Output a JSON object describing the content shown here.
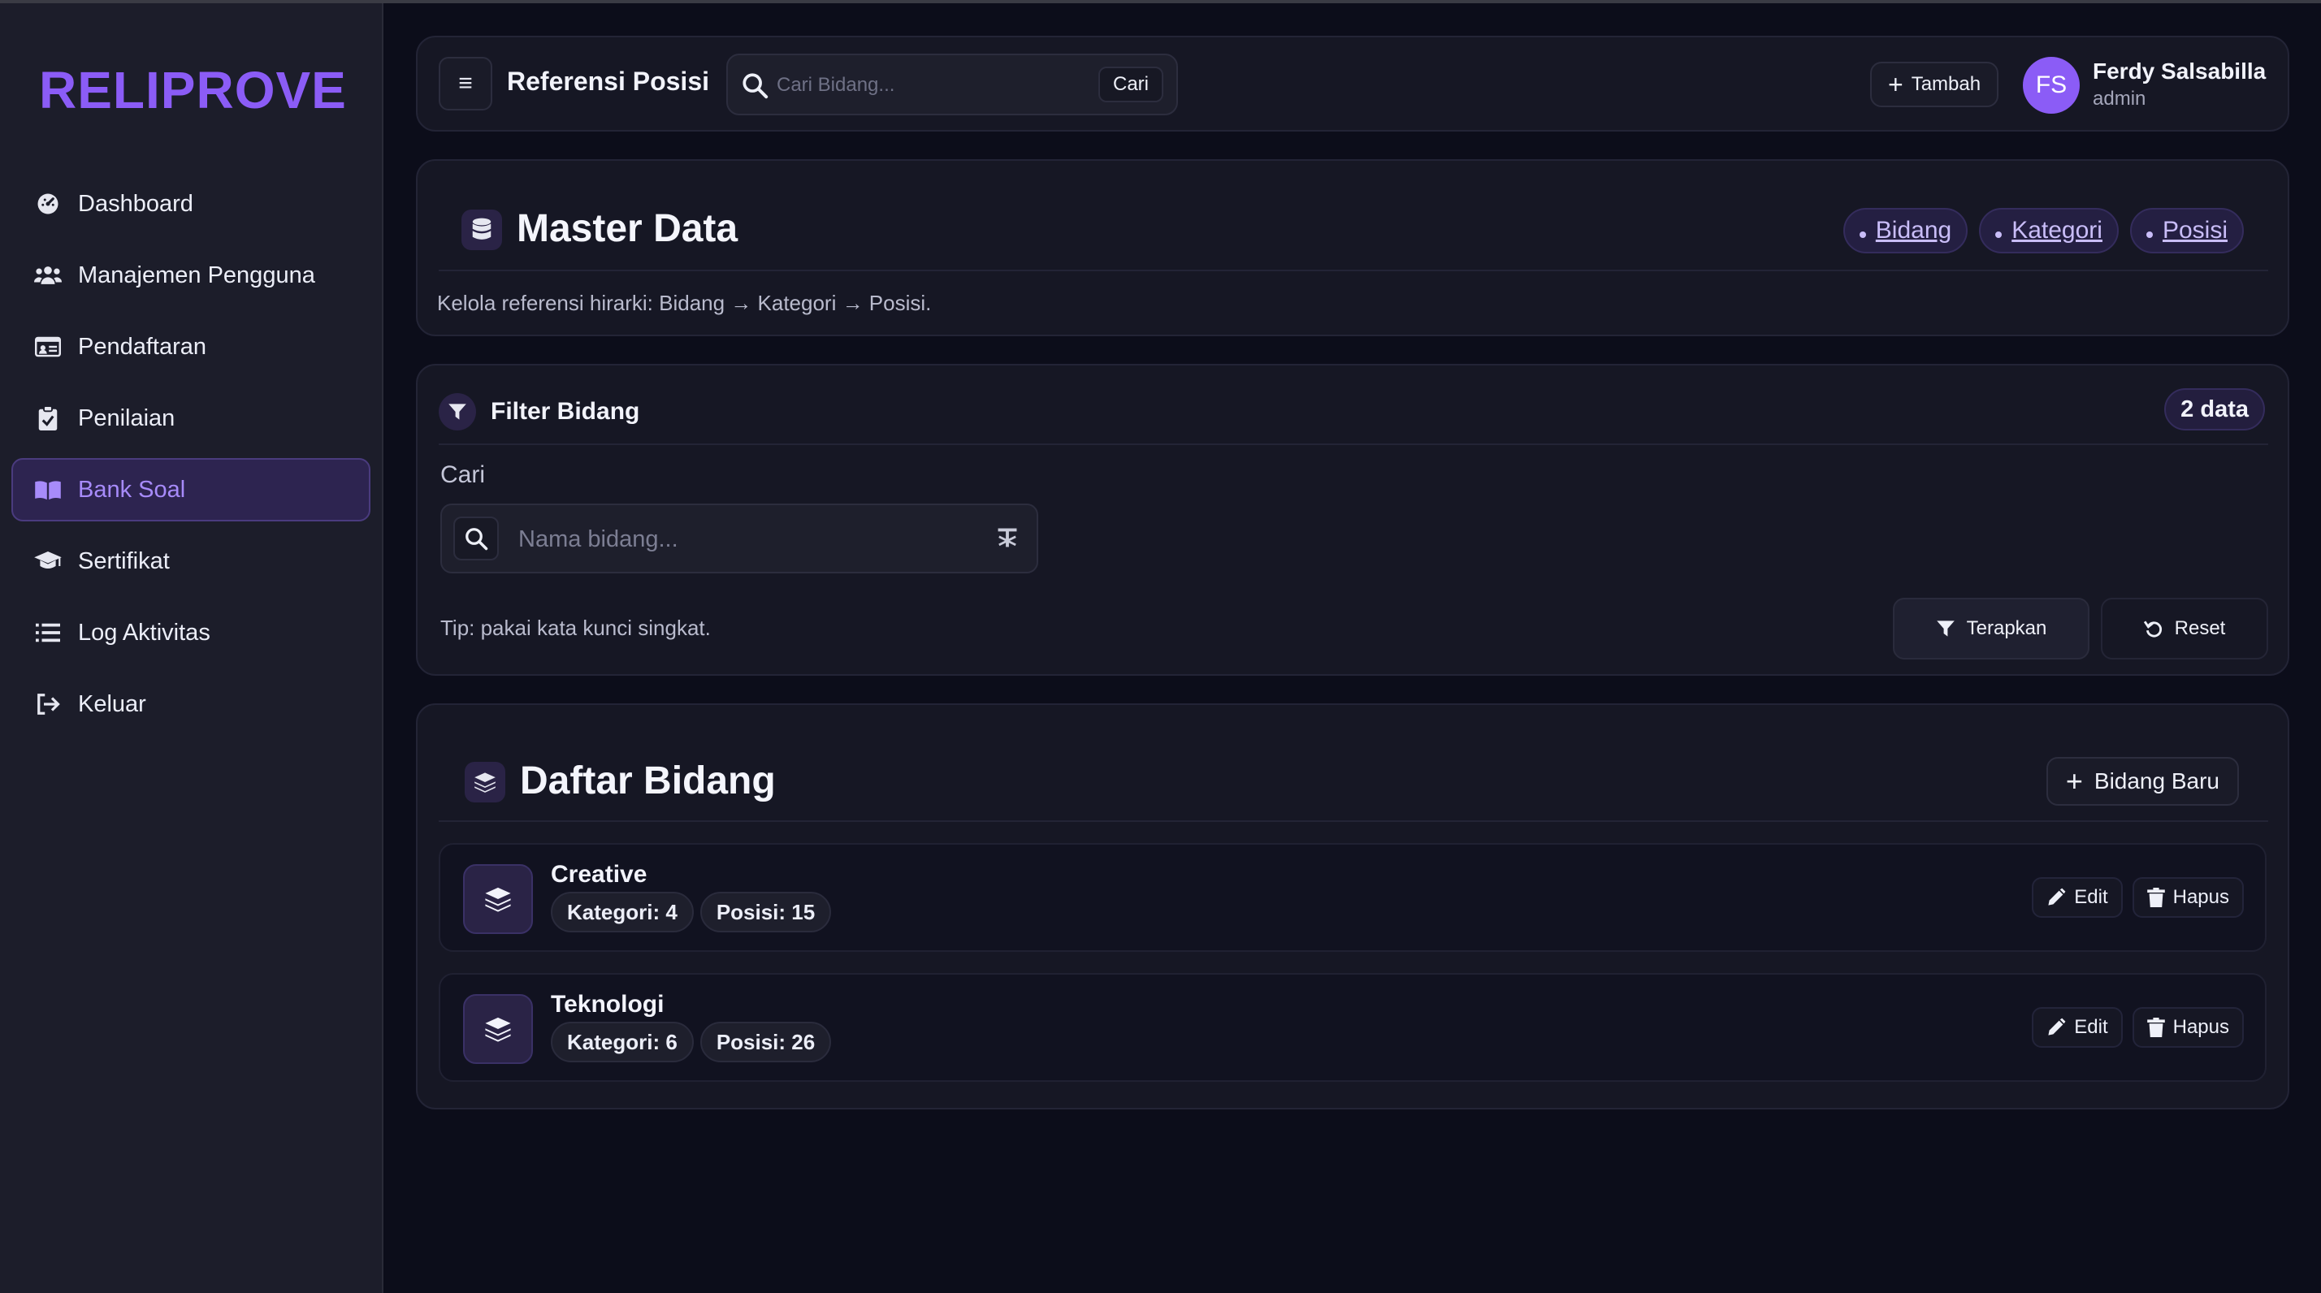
{
  "brand": "RELIPROVE",
  "sidebar": {
    "items": [
      {
        "label": "Dashboard",
        "icon": "dashboard-icon"
      },
      {
        "label": "Manajemen Pengguna",
        "icon": "users-icon"
      },
      {
        "label": "Pendaftaran",
        "icon": "id-card-icon"
      },
      {
        "label": "Penilaian",
        "icon": "clipboard-check-icon"
      },
      {
        "label": "Bank Soal",
        "icon": "book-open-icon",
        "active": true
      },
      {
        "label": "Sertifikat",
        "icon": "graduation-cap-icon"
      },
      {
        "label": "Log Aktivitas",
        "icon": "list-icon"
      },
      {
        "label": "Keluar",
        "icon": "logout-icon"
      }
    ]
  },
  "header": {
    "title": "Referensi Posisi",
    "search_placeholder": "Cari Bidang...",
    "search_button": "Cari",
    "add_button": "Tambah",
    "user": {
      "initials": "FS",
      "name": "Ferdy Salsabilla",
      "role": "admin"
    }
  },
  "master": {
    "title": "Master Data",
    "chips": [
      "Bidang",
      "Kategori",
      "Posisi"
    ],
    "description": "Kelola referensi hirarki: Bidang → Kategori → Posisi."
  },
  "filter": {
    "title": "Filter Bidang",
    "count": "2 data",
    "label": "Cari",
    "placeholder": "Nama bidang...",
    "tip": "Tip: pakai kata kunci singkat.",
    "apply": "Terapkan",
    "reset": "Reset"
  },
  "list": {
    "title": "Daftar Bidang",
    "new_button": "Bidang Baru",
    "edit_label": "Edit",
    "delete_label": "Hapus",
    "rows": [
      {
        "name": "Creative",
        "kategori": "Kategori: 4",
        "posisi": "Posisi: 15"
      },
      {
        "name": "Teknologi",
        "kategori": "Kategori: 6",
        "posisi": "Posisi: 26"
      }
    ]
  },
  "colors": {
    "accent": "#8b5cf6",
    "background": "#0c0d1a",
    "sidebar": "#1c1d2a",
    "card": "#161724"
  }
}
